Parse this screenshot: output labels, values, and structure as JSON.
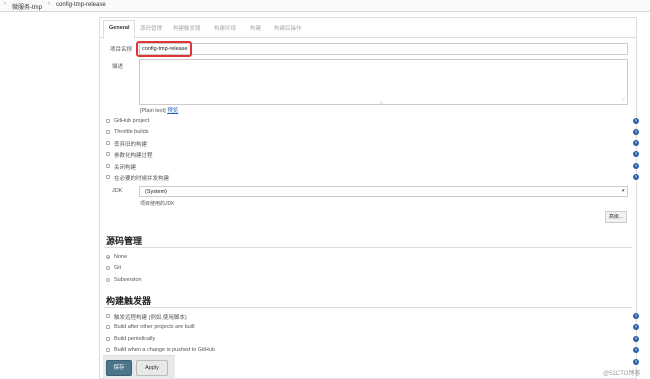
{
  "breadcrumb": {
    "items": [
      "微服务-tmp",
      "config-tmp-release"
    ]
  },
  "tabs": [
    "General",
    "源码管理",
    "构建触发器",
    "构建环境",
    "构建",
    "构建后操作"
  ],
  "general": {
    "project_name_label": "项目名称",
    "project_name_value": "config-tmp-release",
    "description_label": "描述",
    "plain_text_prefix": "[Plain text]",
    "preview_link": "预览",
    "options": [
      "GitHub project",
      "Throttle builds",
      "丢弃旧的构建",
      "参数化构建过程",
      "关闭构建",
      "在必要的时候并发构建"
    ],
    "jdk_label": "JDK",
    "jdk_value": "(System)",
    "jdk_hint": "项目使用的JDK",
    "advanced_button": "高级..."
  },
  "scm": {
    "title": "源码管理",
    "options": [
      "None",
      "Git",
      "Subversion"
    ],
    "selected": "None"
  },
  "triggers": {
    "title": "构建触发器",
    "options": [
      "触发远程构建 (例如,使用脚本)",
      "Build after other projects are built",
      "Build periodically",
      "Build when a change is pushed to GitHub"
    ]
  },
  "footer": {
    "save_label": "保存",
    "apply_label": "Apply"
  },
  "watermark": "@51CTO博客",
  "colors": {
    "accent_red": "#e03535",
    "help_blue": "#2f5fa8",
    "save_button": "#4b758b"
  }
}
